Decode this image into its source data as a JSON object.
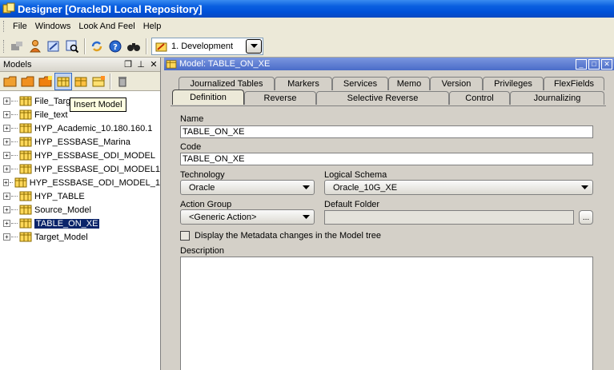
{
  "window": {
    "title": "Designer [OracleDI Local Repository]"
  },
  "menu": [
    "File",
    "Windows",
    "Look And Feel",
    "Help"
  ],
  "toolbar": {
    "context": "1. Development"
  },
  "left_panel": {
    "title": "Models",
    "tooltip": "Insert Model",
    "tree": [
      {
        "label": "File_Target",
        "selected": false
      },
      {
        "label": "File_text",
        "selected": false
      },
      {
        "label": "HYP_Academic_10.180.160.1",
        "selected": false
      },
      {
        "label": "HYP_ESSBASE_Marina",
        "selected": false
      },
      {
        "label": "HYP_ESSBASE_ODI_MODEL",
        "selected": false
      },
      {
        "label": "HYP_ESSBASE_ODI_MODEL1",
        "selected": false
      },
      {
        "label": "HYP_ESSBASE_ODI_MODEL_1",
        "selected": false
      },
      {
        "label": "HYP_TABLE",
        "selected": false
      },
      {
        "label": "Source_Model",
        "selected": false
      },
      {
        "label": "TABLE_ON_XE",
        "selected": true
      },
      {
        "label": "Target_Model",
        "selected": false
      }
    ]
  },
  "right_panel": {
    "title": "Model: TABLE_ON_XE",
    "tabs_back": [
      "Journalized Tables",
      "Markers",
      "Services",
      "Memo",
      "Version",
      "Privileges",
      "FlexFields"
    ],
    "tabs_front": [
      "Definition",
      "Reverse",
      "Selective Reverse",
      "Control",
      "Journalizing"
    ],
    "form": {
      "name_label": "Name",
      "name_value": "TABLE_ON_XE",
      "code_label": "Code",
      "code_value": "TABLE_ON_XE",
      "technology_label": "Technology",
      "technology_value": "Oracle",
      "logical_schema_label": "Logical Schema",
      "logical_schema_value": "Oracle_10G_XE",
      "action_group_label": "Action Group",
      "action_group_value": "<Generic Action>",
      "default_folder_label": "Default Folder",
      "default_folder_value": "",
      "ellipsis": "...",
      "metadata_checkbox_label": "Display the Metadata changes in the Model tree",
      "description_label": "Description"
    }
  }
}
